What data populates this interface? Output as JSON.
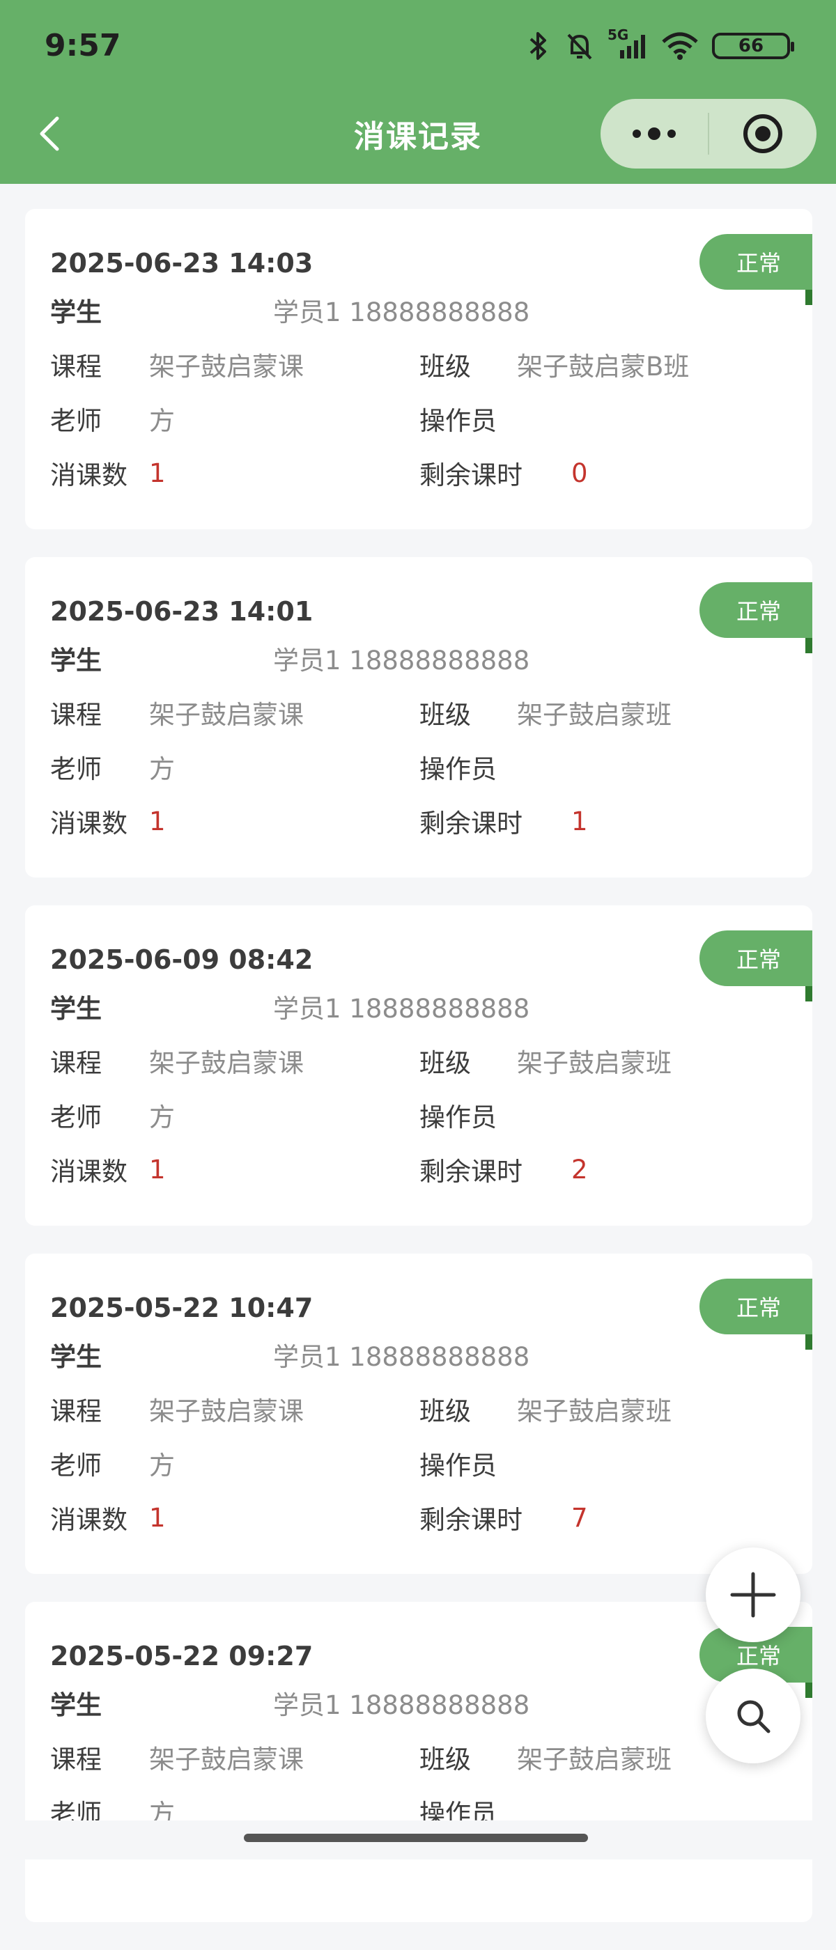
{
  "status_bar": {
    "time": "9:57",
    "network": "5G",
    "battery": "66",
    "icons": [
      "bluetooth-icon",
      "bell-muted-icon",
      "signal-icon",
      "wifi-icon",
      "battery-icon"
    ]
  },
  "navbar": {
    "title": "消课记录",
    "back_icon": "chevron-left-icon",
    "menu_icon": "more-dots-icon",
    "close_icon": "target-circle-icon"
  },
  "labels": {
    "student": "学生",
    "course": "课程",
    "class": "班级",
    "teacher": "老师",
    "operator": "操作员",
    "consumed": "消课数",
    "remaining": "剩余课时"
  },
  "records": [
    {
      "datetime": "2025-06-23 14:03",
      "status": "正常",
      "student": "学员1 18888888888",
      "course": "架子鼓启蒙课",
      "class": "架子鼓启蒙B班",
      "teacher": "方",
      "operator": "",
      "consumed": "1",
      "remaining": "0"
    },
    {
      "datetime": "2025-06-23 14:01",
      "status": "正常",
      "student": "学员1 18888888888",
      "course": "架子鼓启蒙课",
      "class": "架子鼓启蒙班",
      "teacher": "方",
      "operator": "",
      "consumed": "1",
      "remaining": "1"
    },
    {
      "datetime": "2025-06-09 08:42",
      "status": "正常",
      "student": "学员1 18888888888",
      "course": "架子鼓启蒙课",
      "class": "架子鼓启蒙班",
      "teacher": "方",
      "operator": "",
      "consumed": "1",
      "remaining": "2"
    },
    {
      "datetime": "2025-05-22 10:47",
      "status": "正常",
      "student": "学员1 18888888888",
      "course": "架子鼓启蒙课",
      "class": "架子鼓启蒙班",
      "teacher": "方",
      "operator": "",
      "consumed": "1",
      "remaining": "7"
    },
    {
      "datetime": "2025-05-22 09:27",
      "status": "正常",
      "student": "学员1 18888888888",
      "course": "架子鼓启蒙课",
      "class": "架子鼓启蒙班",
      "teacher": "方",
      "operator": "",
      "consumed": "",
      "remaining": ""
    }
  ],
  "fab": {
    "add_icon": "plus-icon",
    "search_icon": "search-icon"
  },
  "colors": {
    "brand_green": "#66b068",
    "value_red": "#c4342d",
    "background": "#f5f6f8"
  }
}
